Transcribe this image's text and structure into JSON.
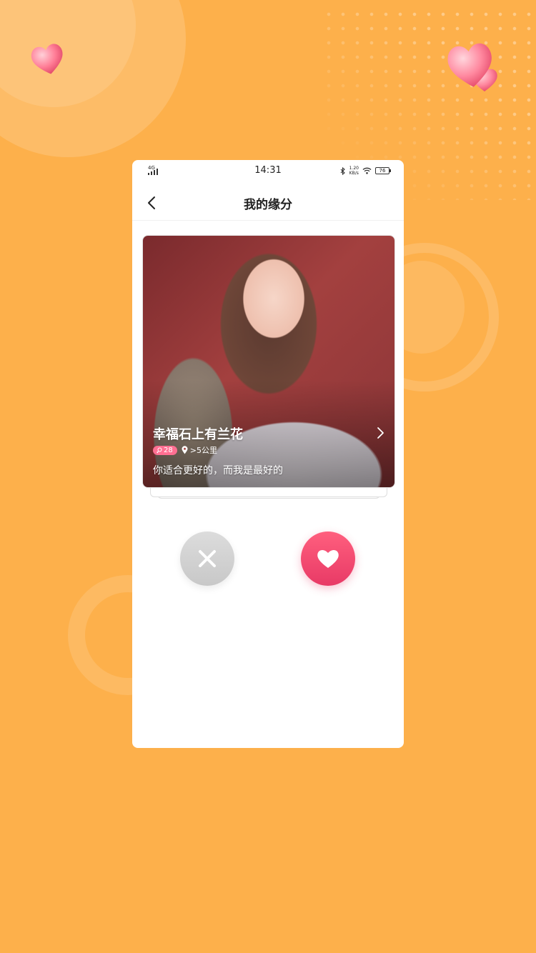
{
  "status_bar": {
    "network": "4G",
    "time": "14:31",
    "speed": "1.20\nKB/s",
    "battery": "76"
  },
  "nav": {
    "title": "我的缘分"
  },
  "card": {
    "name": "幸福石上有兰花",
    "age": "28",
    "distance": ">5公里",
    "bio": "你适合更好的，而我是最好的"
  },
  "colors": {
    "background": "#fdb04b",
    "like_button": "#ff5f7e",
    "dislike_button": "#d6d6d6",
    "age_badge": "#ff6f92"
  },
  "icons": {
    "back": "chevron-left-icon",
    "close": "close-icon",
    "heart": "heart-icon",
    "location": "location-pin-icon",
    "arrow": "chevron-right-icon"
  }
}
